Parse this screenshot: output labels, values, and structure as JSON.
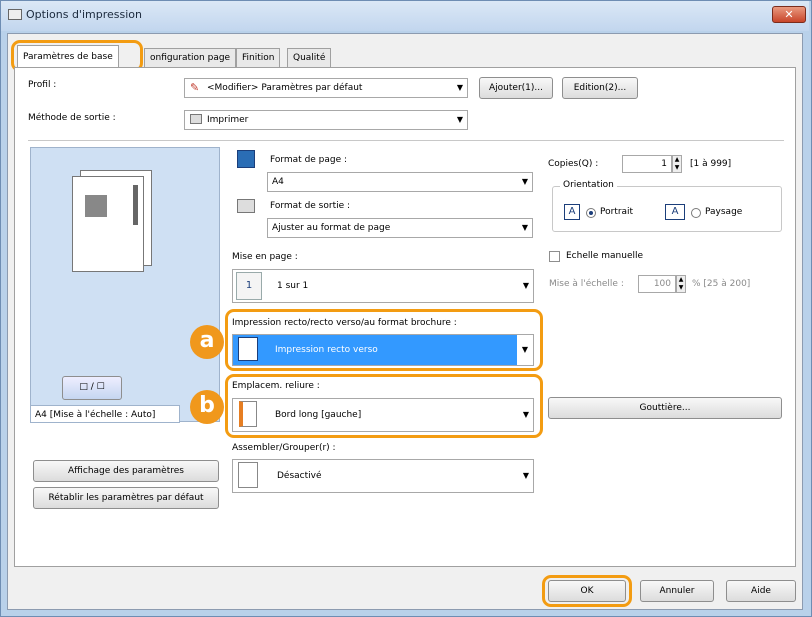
{
  "window": {
    "title": "Options d'impression",
    "close_label": "✕"
  },
  "tabs": [
    {
      "label": "Paramètres de base"
    },
    {
      "label": "onfiguration page"
    },
    {
      "label": "Finition"
    },
    {
      "label": "Qualité"
    }
  ],
  "profile": {
    "label": "Profil :",
    "value": "<Modifier> Paramètres par défaut",
    "add_button": "Ajouter(1)...",
    "edit_button": "Edition(2)..."
  },
  "output_method": {
    "label": "Méthode de sortie :",
    "value": "Imprimer"
  },
  "page_size": {
    "label": "Format de page :",
    "value": "A4"
  },
  "output_size": {
    "label": "Format de sortie :",
    "value": "Ajuster au format de page"
  },
  "layout": {
    "label": "Mise en page :",
    "value": "1 sur 1"
  },
  "duplex": {
    "label": "Impression recto/recto verso/au format brochure :",
    "value": "Impression recto verso"
  },
  "binding": {
    "label": "Emplacem. reliure :",
    "value": "Bord long [gauche]"
  },
  "collate": {
    "label": "Assembler/Grouper(r) :",
    "value": "Désactivé"
  },
  "copies": {
    "label": "Copies(Q) :",
    "value": "1",
    "range": "[1 à 999]"
  },
  "orientation": {
    "label": "Orientation",
    "portrait": "Portrait",
    "landscape": "Paysage",
    "selected": "portrait"
  },
  "scaling": {
    "label": "Echelle manuelle",
    "scale_label": "Mise à l'échelle :",
    "value": "100",
    "range": "% [25 à 200]"
  },
  "gutter_button": "Gouttière...",
  "preview": {
    "caption": "A4 [Mise à l'échelle : Auto]",
    "toggle_label": "□ / ☐"
  },
  "left_buttons": {
    "show_settings": "Affichage des paramètres",
    "restore_defaults": "Rétablir les paramètres par défaut"
  },
  "badges": {
    "a": "a",
    "b": "b"
  },
  "footer": {
    "ok": "OK",
    "cancel": "Annuler",
    "help": "Aide"
  },
  "colors": {
    "highlight": "#f39c12",
    "selected_combo": "#3399ff"
  }
}
